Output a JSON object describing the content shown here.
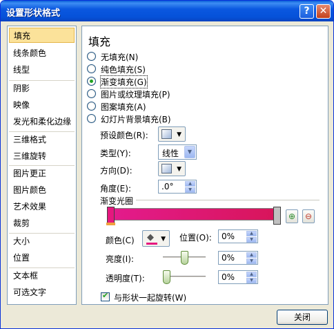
{
  "window": {
    "title": "设置形状格式",
    "help_label": "?",
    "close_label": "✕"
  },
  "sidebar": {
    "items": [
      {
        "label": "填充"
      },
      {
        "label": "线条颜色"
      },
      {
        "label": "线型"
      },
      {
        "label": "阴影"
      },
      {
        "label": "映像"
      },
      {
        "label": "发光和柔化边缘"
      },
      {
        "label": "三维格式"
      },
      {
        "label": "三维旋转"
      },
      {
        "label": "图片更正"
      },
      {
        "label": "图片颜色"
      },
      {
        "label": "艺术效果"
      },
      {
        "label": "裁剪"
      },
      {
        "label": "大小"
      },
      {
        "label": "位置"
      },
      {
        "label": "文本框"
      },
      {
        "label": "可选文字"
      }
    ],
    "selected": "填充"
  },
  "panel": {
    "heading": "填充",
    "fill_options": [
      {
        "label": "无填充(N)"
      },
      {
        "label": "纯色填充(S)"
      },
      {
        "label": "渐变填充(G)"
      },
      {
        "label": "图片或纹理填充(P)"
      },
      {
        "label": "图案填充(A)"
      },
      {
        "label": "幻灯片背景填充(B)"
      }
    ],
    "selected_fill": "渐变填充(G)",
    "preset_label": "预设颜色(R):",
    "type_label": "类型(Y):",
    "type_value": "线性",
    "direction_label": "方向(D):",
    "angle_label": "角度(E):",
    "angle_value": ".0°",
    "stops_label": "渐变光圈",
    "add_stop_icon": "add-gradient-stop-icon",
    "remove_stop_icon": "remove-gradient-stop-icon",
    "color_label": "颜色(C)",
    "position_label": "位置(O):",
    "position_value": "0%",
    "brightness_label": "亮度(I):",
    "brightness_value": "0%",
    "brightness_level": 0.5,
    "transparency_label": "透明度(T):",
    "transparency_value": "0%",
    "transparency_level": 0.0,
    "rotate_with_shape_label": "与形状一起旋转(W)",
    "rotate_with_shape_checked": true,
    "gradient_colors": [
      "#e31b8c",
      "#d8155a"
    ]
  },
  "footer": {
    "close_label": "关闭"
  }
}
